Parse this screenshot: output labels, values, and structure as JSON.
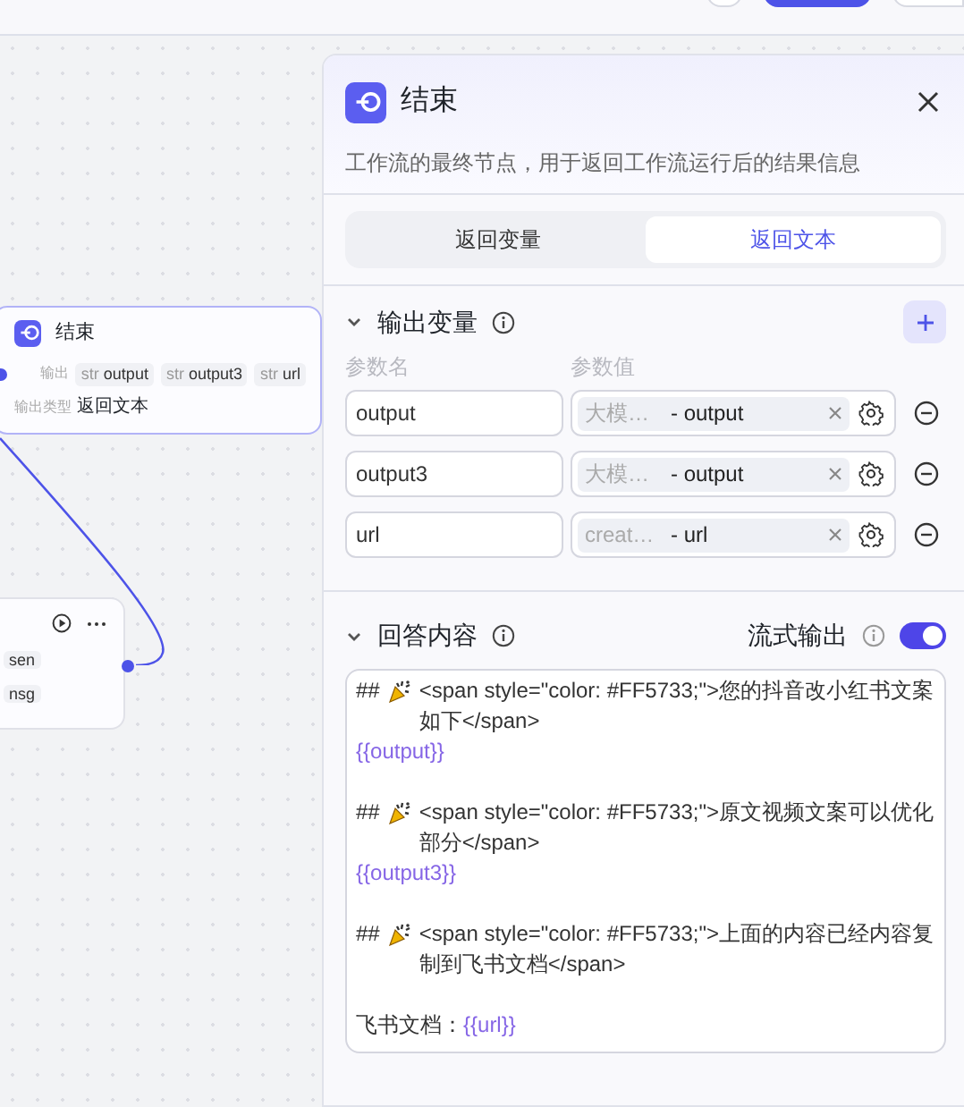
{
  "toolbar": {
    "buttons": [
      {
        "kind": "outline"
      },
      {
        "kind": "primary"
      },
      {
        "kind": "outline"
      }
    ]
  },
  "canvas": {
    "nodes": [
      {
        "kind": "full",
        "title": "结束",
        "rows": [
          {
            "label": "输出",
            "chips": [
              {
                "type": "str",
                "name": "output"
              },
              {
                "type": "str",
                "name": "output3"
              },
              {
                "type": "str",
                "name": "url"
              }
            ]
          },
          {
            "label": "输出类型",
            "value": "返回文本"
          }
        ]
      },
      {
        "kind": "partial",
        "chips": [
          {
            "name": "sen"
          },
          {
            "name": "nsg"
          }
        ]
      }
    ]
  },
  "panel": {
    "title": "结束",
    "description": "工作流的最终节点，用于返回工作流运行后的结果信息",
    "tabs": [
      {
        "label": "返回变量",
        "selected": false
      },
      {
        "label": "返回文本",
        "selected": true
      }
    ],
    "outputs": {
      "title": "输出变量",
      "expanded": true,
      "columns": [
        "参数名",
        "参数值"
      ],
      "rows": [
        {
          "name": "output",
          "source": "大模…",
          "field": "- output"
        },
        {
          "name": "output3",
          "source": "大模…",
          "field": "- output"
        },
        {
          "name": "url",
          "source": "creat…",
          "field": "- url"
        }
      ]
    },
    "answer": {
      "title": "回答内容",
      "expanded": true,
      "streaming": {
        "label": "流式输出",
        "on": true
      },
      "lines": [
        {
          "kind": "heading",
          "prefix": "##",
          "text": "<span style=\"color: #FF5733;\">您的抖音改小红书文案如下</span>"
        },
        {
          "kind": "variable",
          "text": "{{output}}"
        },
        {
          "kind": "blank"
        },
        {
          "kind": "heading",
          "prefix": "##",
          "text": "<span style=\"color: #FF5733;\">原文视频文案可以优化部分</span>"
        },
        {
          "kind": "variable",
          "text": "{{output3}}"
        },
        {
          "kind": "blank"
        },
        {
          "kind": "heading",
          "prefix": "##",
          "text": "<span style=\"color: #FF5733;\">上面的内容已经内容复制到飞书文档</span>"
        },
        {
          "kind": "blank"
        },
        {
          "kind": "mixed",
          "text": "飞书文档：",
          "variable": "{{url}}"
        }
      ]
    }
  }
}
